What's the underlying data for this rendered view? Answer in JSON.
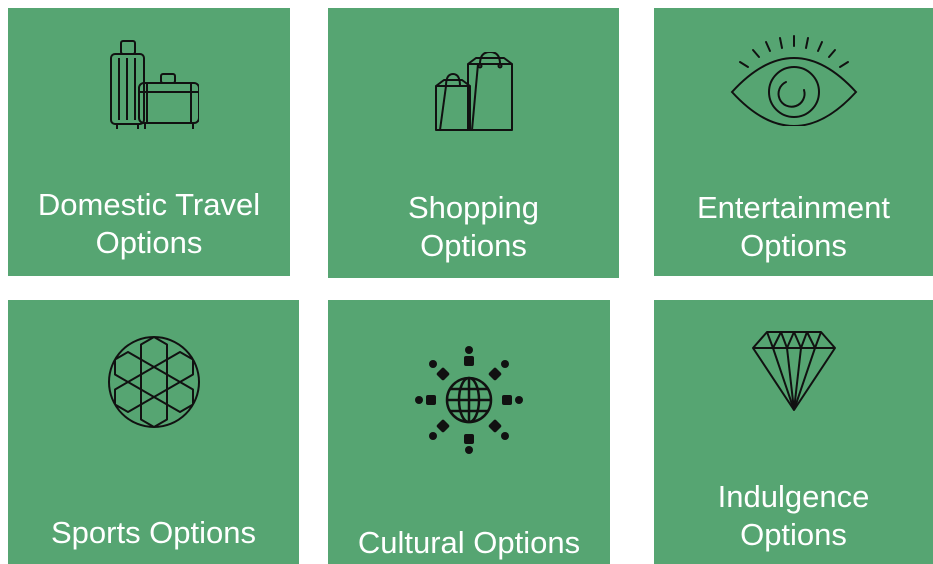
{
  "colors": {
    "tile_background": "#56a572",
    "label_text": "#ffffff",
    "icon_stroke": "#111111",
    "page_background": "#ffffff"
  },
  "tiles": [
    {
      "label": "Domestic Travel\nOptions",
      "icon": "luggage-icon"
    },
    {
      "label": "Shopping\nOptions",
      "icon": "shopping-bags-icon"
    },
    {
      "label": "Entertainment\nOptions",
      "icon": "eye-icon"
    },
    {
      "label": "Sports Options",
      "icon": "soccer-ball-icon"
    },
    {
      "label": "Cultural Options",
      "icon": "globe-people-icon"
    },
    {
      "label": "Indulgence\nOptions",
      "icon": "diamond-icon"
    }
  ]
}
